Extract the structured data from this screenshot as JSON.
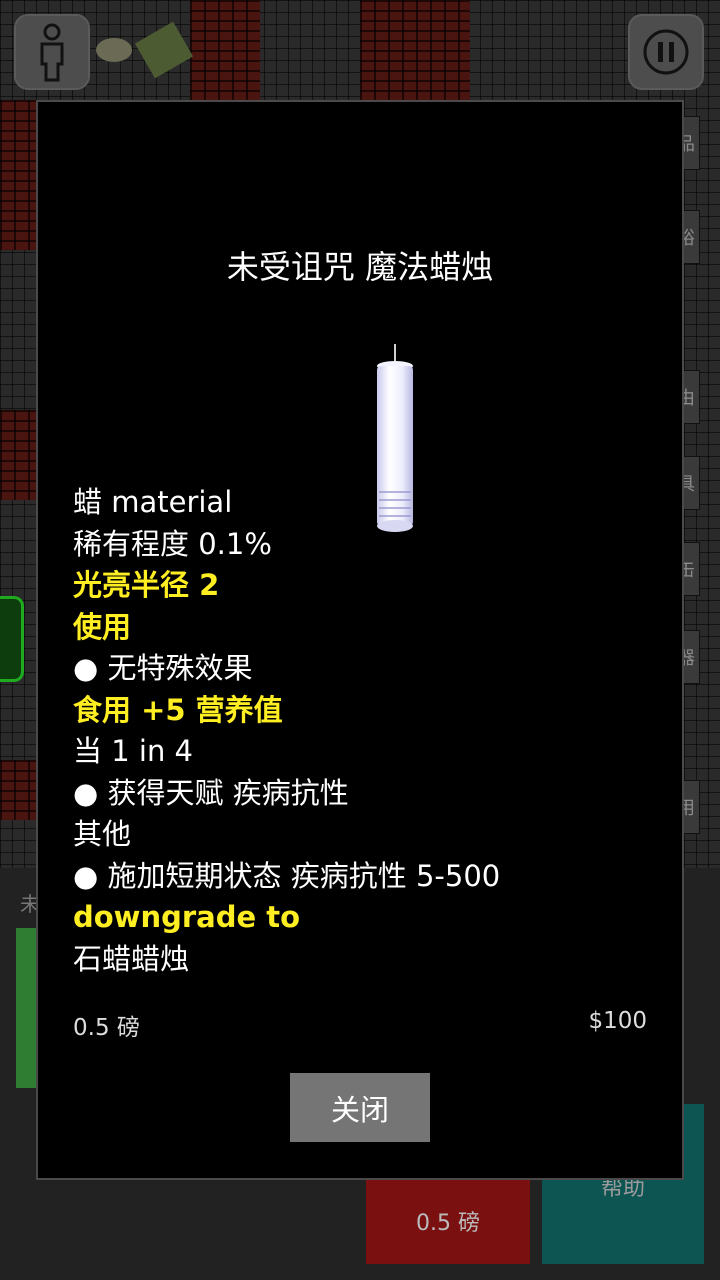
{
  "item": {
    "title": "未受诅咒 魔法蜡烛",
    "image": "white-candle",
    "properties": [
      {
        "text": "蜡 material",
        "highlight": false
      },
      {
        "text": "稀有程度 0.1%",
        "highlight": false
      },
      {
        "text": "光亮半径 2",
        "highlight": true
      },
      {
        "text": "使用",
        "highlight": true
      },
      {
        "text": "● 无特殊效果",
        "highlight": false
      },
      {
        "text": "食用 +5 营养值",
        "highlight": true
      },
      {
        "text": "当 1 in 4",
        "highlight": false
      },
      {
        "text": "● 获得天赋 疾病抗性",
        "highlight": false
      },
      {
        "text": "其他",
        "highlight": false
      },
      {
        "text": "● 施加短期状态 疾病抗性 5-500",
        "highlight": false
      },
      {
        "text": "downgrade to",
        "highlight": true
      },
      {
        "text": "石蜡蜡烛",
        "highlight": false
      }
    ],
    "weight": "0.5 磅",
    "price": "$100"
  },
  "dialog": {
    "close_label": "关闭"
  },
  "background": {
    "side_tabs": [
      "品",
      "裕",
      "由",
      "具",
      "缶",
      "器",
      "用"
    ],
    "bottom_left_char": "未",
    "weight_tile": "0.5 磅",
    "help_tile": "帮助"
  },
  "colors": {
    "highlight": "#ffee22",
    "dialog_bg": "#000000",
    "close_button": "#757575"
  }
}
